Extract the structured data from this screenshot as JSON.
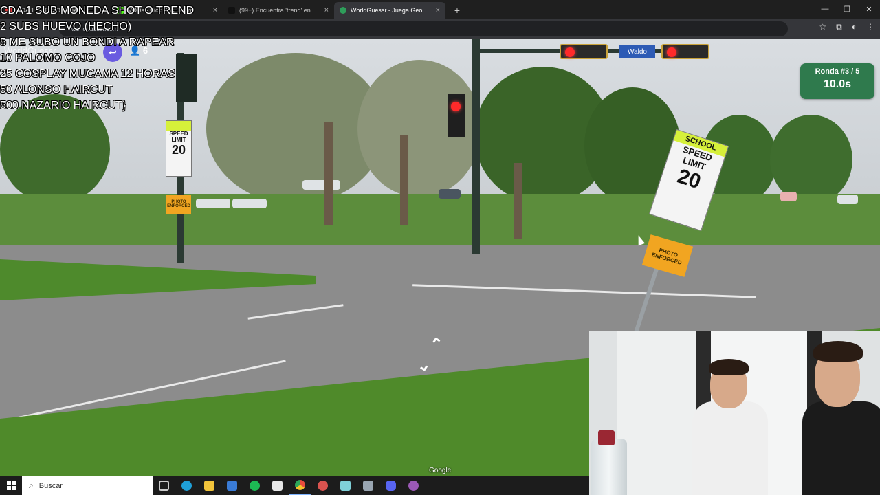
{
  "browser": {
    "tabs": [
      {
        "label": "CDA 1 SUB MONEDA SHOT O TREND",
        "favicon_color": "#e33b3b",
        "active": false
      },
      {
        "label": "VODs - Kick Dashboard",
        "favicon_color": "#53fc18",
        "active": false
      },
      {
        "label": "(99+) Encuentra 'trend' en TikTok",
        "favicon_color": "#111111",
        "active": false
      },
      {
        "label": "WorldGuessr - Juega GeoGuessr",
        "favicon_color": "#2e9d5a",
        "active": true
      }
    ],
    "tab_close_glyph": "×",
    "new_tab_glyph": "+",
    "window_controls": [
      "—",
      "❐",
      "✕"
    ],
    "url": "worldguessr.com",
    "toolbar_icons": [
      "star-icon",
      "extensions-icon",
      "profile-icon",
      "menu-icon"
    ],
    "toolbar_glyphs": [
      "☆",
      "⧉",
      "◐",
      "⋮"
    ]
  },
  "game": {
    "logo": "WorldGuessr",
    "back_glyph": "↩",
    "players_glyph": "👤",
    "players": "6",
    "round_label": "Ronda #3 / 5",
    "timer": "10.0s",
    "street_sign": "Waldo",
    "speed_sign": {
      "top": "SCHOOL",
      "line1": "SPEED",
      "line2": "LIMIT",
      "value": "20"
    },
    "speed_sign_left": {
      "line1": "SPEED",
      "line2": "LIMIT",
      "value": "20"
    },
    "photo_sign": "PHOTO ENFORCED",
    "attribution": "Google"
  },
  "overlay": {
    "goals": [
      "CDA 1 SUB MONEDA SHOT O TREND",
      "2 SUBS HUEVO (HECHO)",
      "5 ME SUBO UN BONDI A RAPEAR",
      "10 PALOMO COJO",
      "25 COSPLAY MUCAMA 12 HORAS",
      "50 ALONSO HAIRCUT",
      "500 NAZARIO HAIRCUT}"
    ]
  },
  "taskbar": {
    "search_placeholder": "Buscar",
    "apps": [
      {
        "name": "task-view-icon",
        "color": "#cccccc"
      },
      {
        "name": "edge-icon",
        "color": "#1fa0d8"
      },
      {
        "name": "file-explorer-icon",
        "color": "#f2c43b"
      },
      {
        "name": "mail-icon",
        "color": "#3a7bd5"
      },
      {
        "name": "spotify-icon",
        "color": "#1db954"
      },
      {
        "name": "store-icon",
        "color": "#e8e8e8"
      },
      {
        "name": "chrome-icon",
        "color": "#e84c3d"
      },
      {
        "name": "recorder-icon",
        "color": "#d9534f"
      },
      {
        "name": "app-icon",
        "color": "#7fd0d8"
      },
      {
        "name": "calculator-icon",
        "color": "#9aa6b2"
      },
      {
        "name": "discord-icon",
        "color": "#5865f2"
      },
      {
        "name": "media-player-icon",
        "color": "#9b59b6"
      }
    ]
  }
}
